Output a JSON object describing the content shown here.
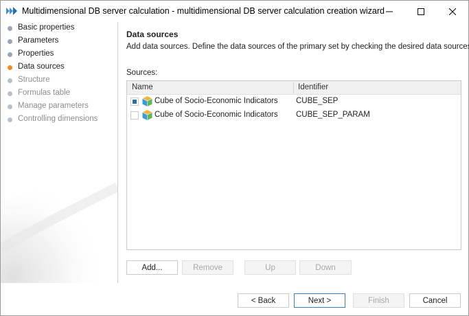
{
  "window": {
    "title": "Multidimensional DB server calculation - multidimensional DB server calculation creation wizard"
  },
  "steps": [
    {
      "label": "Basic properties",
      "state": "done"
    },
    {
      "label": "Parameters",
      "state": "done"
    },
    {
      "label": "Properties",
      "state": "done"
    },
    {
      "label": "Data sources",
      "state": "current"
    },
    {
      "label": "Structure",
      "state": "pending"
    },
    {
      "label": "Formulas table",
      "state": "pending"
    },
    {
      "label": "Manage parameters",
      "state": "pending"
    },
    {
      "label": "Controlling dimensions",
      "state": "pending"
    }
  ],
  "page": {
    "title": "Data sources",
    "description": "Add data sources. Define the data sources of the primary set by checking the desired data sources.",
    "sources_label": "Sources:"
  },
  "grid": {
    "columns": {
      "name": "Name",
      "identifier": "Identifier"
    },
    "rows": [
      {
        "name": "Cube of Socio-Economic Indicators",
        "identifier": "CUBE_SEP",
        "checked": true
      },
      {
        "name": "Cube of Socio-Economic Indicators",
        "identifier": "CUBE_SEP_PARAM",
        "checked": false
      }
    ]
  },
  "list_buttons": {
    "add": "Add...",
    "remove": "Remove",
    "up": "Up",
    "down": "Down"
  },
  "footer": {
    "back": "< Back",
    "next": "Next >",
    "finish": "Finish",
    "cancel": "Cancel"
  },
  "colors": {
    "current_step": "#f08c1e",
    "done_step": "#9aa6b8",
    "pending_step": "#b8c0cc",
    "accent": "#2a6fb6"
  },
  "icons": {
    "app": "wizard-arrows-icon",
    "cube": "cube-icon",
    "minimize": "minimize-icon",
    "maximize": "maximize-icon",
    "close": "close-icon"
  }
}
